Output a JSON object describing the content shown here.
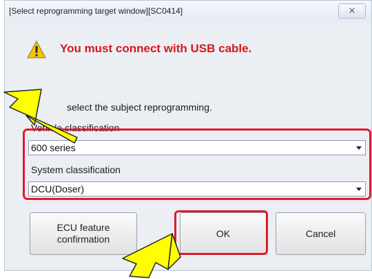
{
  "dialog": {
    "title": "[Select reprogramming target window][SC0414]",
    "close_label": "✕",
    "warning": "You must connect with USB cable.",
    "instruction": "select the subject reprogramming.",
    "vehicle_label": "Vehicle classification",
    "vehicle_value": "600 series",
    "system_label": "System classification",
    "system_value": "DCU(Doser)"
  },
  "buttons": {
    "ecu_line1": "ECU feature",
    "ecu_line2": "confirmation",
    "ok": "OK",
    "cancel": "Cancel"
  },
  "annotations": {
    "highlight_color": "#e0182a",
    "arrow_color": "#ffff00"
  }
}
